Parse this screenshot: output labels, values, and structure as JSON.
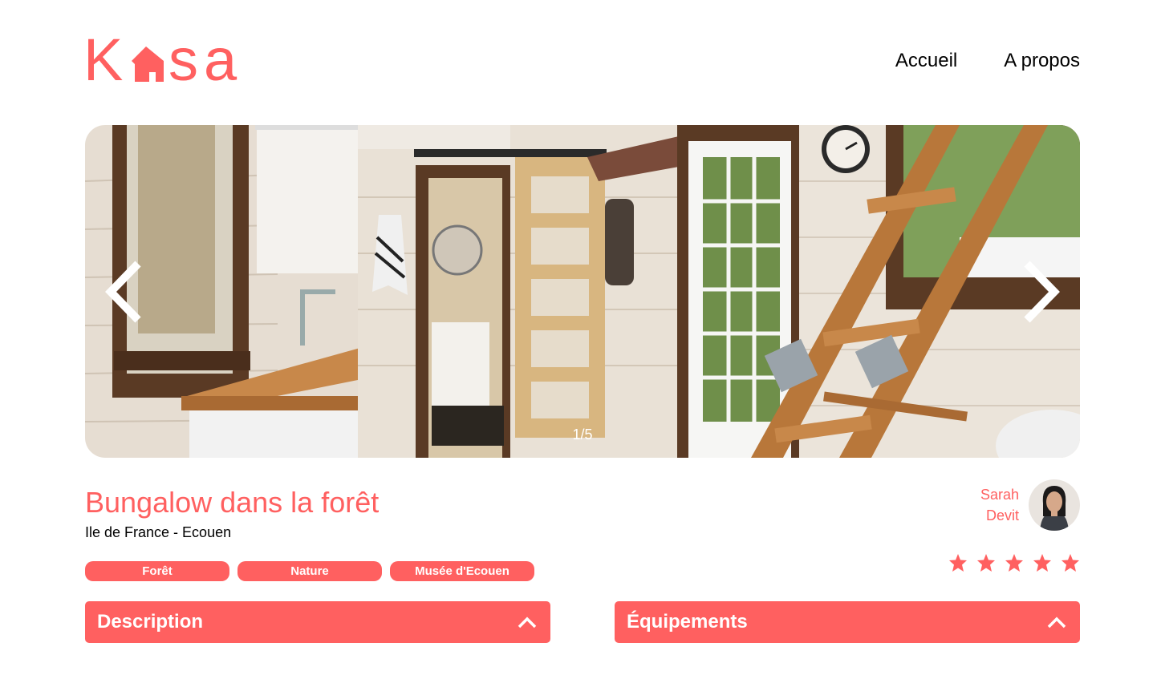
{
  "brand": {
    "letters": [
      "K",
      "s",
      "a"
    ],
    "color": "#FF6060"
  },
  "nav": {
    "items": [
      {
        "label": "Accueil"
      },
      {
        "label": "A propos"
      }
    ]
  },
  "gallery": {
    "counter": "1/5",
    "prev_icon": "chevron-left-icon",
    "next_icon": "chevron-right-icon"
  },
  "listing": {
    "title": "Bungalow dans la forêt",
    "location": "Ile de France - Ecouen",
    "tags": [
      "Forêt",
      "Nature",
      "Musée d'Ecouen"
    ],
    "rating": 5,
    "rating_max": 5
  },
  "host": {
    "first_name": "Sarah",
    "last_name": "Devit"
  },
  "sections": [
    {
      "title": "Description",
      "icon": "chevron-up-icon"
    },
    {
      "title": "Équipements",
      "icon": "chevron-up-icon"
    }
  ],
  "colors": {
    "accent": "#FF6060",
    "white": "#FFFFFF"
  }
}
